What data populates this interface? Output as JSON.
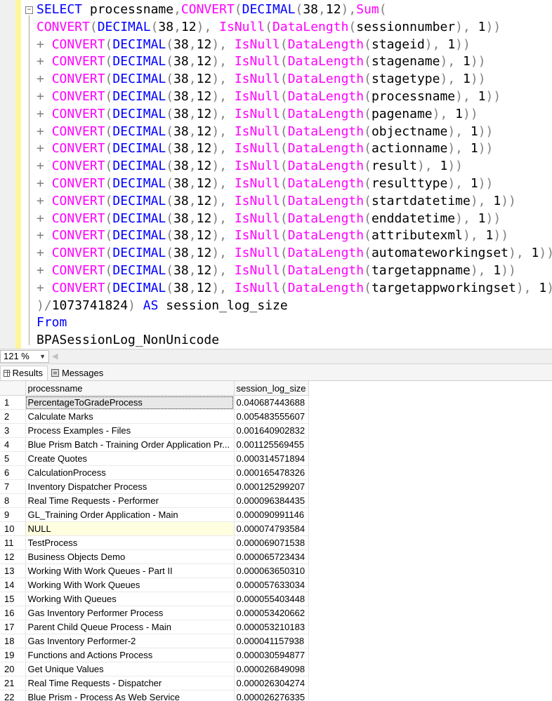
{
  "editor": {
    "lines": [
      [
        [
          "kw",
          "SELECT"
        ],
        [
          "bl",
          " processname"
        ],
        [
          "gy",
          ","
        ],
        [
          "fn",
          "CONVERT"
        ],
        [
          "gy",
          "("
        ],
        [
          "kw",
          "DECIMAL"
        ],
        [
          "gy",
          "("
        ],
        [
          "bl",
          "38"
        ],
        [
          "gy",
          ","
        ],
        [
          "bl",
          "12"
        ],
        [
          "gy",
          "),"
        ],
        [
          "fn",
          "Sum"
        ],
        [
          "gy",
          "("
        ]
      ],
      [
        [
          "fn",
          "CONVERT"
        ],
        [
          "gy",
          "("
        ],
        [
          "kw",
          "DECIMAL"
        ],
        [
          "gy",
          "("
        ],
        [
          "bl",
          "38"
        ],
        [
          "gy",
          ","
        ],
        [
          "bl",
          "12"
        ],
        [
          "gy",
          "),"
        ],
        [
          "bl",
          " "
        ],
        [
          "fn",
          "IsNull"
        ],
        [
          "gy",
          "("
        ],
        [
          "fn",
          "DataLength"
        ],
        [
          "gy",
          "("
        ],
        [
          "bl",
          "sessionnumber"
        ],
        [
          "gy",
          "),"
        ],
        [
          "bl",
          " 1"
        ],
        [
          "gy",
          "))"
        ]
      ],
      [
        [
          "gy",
          "+ "
        ],
        [
          "fn",
          "CONVERT"
        ],
        [
          "gy",
          "("
        ],
        [
          "kw",
          "DECIMAL"
        ],
        [
          "gy",
          "("
        ],
        [
          "bl",
          "38"
        ],
        [
          "gy",
          ","
        ],
        [
          "bl",
          "12"
        ],
        [
          "gy",
          "),"
        ],
        [
          "bl",
          " "
        ],
        [
          "fn",
          "IsNull"
        ],
        [
          "gy",
          "("
        ],
        [
          "fn",
          "DataLength"
        ],
        [
          "gy",
          "("
        ],
        [
          "bl",
          "stageid"
        ],
        [
          "gy",
          "),"
        ],
        [
          "bl",
          " 1"
        ],
        [
          "gy",
          "))"
        ]
      ],
      [
        [
          "gy",
          "+ "
        ],
        [
          "fn",
          "CONVERT"
        ],
        [
          "gy",
          "("
        ],
        [
          "kw",
          "DECIMAL"
        ],
        [
          "gy",
          "("
        ],
        [
          "bl",
          "38"
        ],
        [
          "gy",
          ","
        ],
        [
          "bl",
          "12"
        ],
        [
          "gy",
          "),"
        ],
        [
          "bl",
          " "
        ],
        [
          "fn",
          "IsNull"
        ],
        [
          "gy",
          "("
        ],
        [
          "fn",
          "DataLength"
        ],
        [
          "gy",
          "("
        ],
        [
          "bl",
          "stagename"
        ],
        [
          "gy",
          "),"
        ],
        [
          "bl",
          " 1"
        ],
        [
          "gy",
          "))"
        ]
      ],
      [
        [
          "gy",
          "+ "
        ],
        [
          "fn",
          "CONVERT"
        ],
        [
          "gy",
          "("
        ],
        [
          "kw",
          "DECIMAL"
        ],
        [
          "gy",
          "("
        ],
        [
          "bl",
          "38"
        ],
        [
          "gy",
          ","
        ],
        [
          "bl",
          "12"
        ],
        [
          "gy",
          "),"
        ],
        [
          "bl",
          " "
        ],
        [
          "fn",
          "IsNull"
        ],
        [
          "gy",
          "("
        ],
        [
          "fn",
          "DataLength"
        ],
        [
          "gy",
          "("
        ],
        [
          "bl",
          "stagetype"
        ],
        [
          "gy",
          "),"
        ],
        [
          "bl",
          " 1"
        ],
        [
          "gy",
          "))"
        ]
      ],
      [
        [
          "gy",
          "+ "
        ],
        [
          "fn",
          "CONVERT"
        ],
        [
          "gy",
          "("
        ],
        [
          "kw",
          "DECIMAL"
        ],
        [
          "gy",
          "("
        ],
        [
          "bl",
          "38"
        ],
        [
          "gy",
          ","
        ],
        [
          "bl",
          "12"
        ],
        [
          "gy",
          "),"
        ],
        [
          "bl",
          " "
        ],
        [
          "fn",
          "IsNull"
        ],
        [
          "gy",
          "("
        ],
        [
          "fn",
          "DataLength"
        ],
        [
          "gy",
          "("
        ],
        [
          "bl",
          "processname"
        ],
        [
          "gy",
          "),"
        ],
        [
          "bl",
          " 1"
        ],
        [
          "gy",
          "))"
        ]
      ],
      [
        [
          "gy",
          "+ "
        ],
        [
          "fn",
          "CONVERT"
        ],
        [
          "gy",
          "("
        ],
        [
          "kw",
          "DECIMAL"
        ],
        [
          "gy",
          "("
        ],
        [
          "bl",
          "38"
        ],
        [
          "gy",
          ","
        ],
        [
          "bl",
          "12"
        ],
        [
          "gy",
          "),"
        ],
        [
          "bl",
          " "
        ],
        [
          "fn",
          "IsNull"
        ],
        [
          "gy",
          "("
        ],
        [
          "fn",
          "DataLength"
        ],
        [
          "gy",
          "("
        ],
        [
          "bl",
          "pagename"
        ],
        [
          "gy",
          "),"
        ],
        [
          "bl",
          " 1"
        ],
        [
          "gy",
          "))"
        ]
      ],
      [
        [
          "gy",
          "+ "
        ],
        [
          "fn",
          "CONVERT"
        ],
        [
          "gy",
          "("
        ],
        [
          "kw",
          "DECIMAL"
        ],
        [
          "gy",
          "("
        ],
        [
          "bl",
          "38"
        ],
        [
          "gy",
          ","
        ],
        [
          "bl",
          "12"
        ],
        [
          "gy",
          "),"
        ],
        [
          "bl",
          " "
        ],
        [
          "fn",
          "IsNull"
        ],
        [
          "gy",
          "("
        ],
        [
          "fn",
          "DataLength"
        ],
        [
          "gy",
          "("
        ],
        [
          "bl",
          "objectname"
        ],
        [
          "gy",
          "),"
        ],
        [
          "bl",
          " 1"
        ],
        [
          "gy",
          "))"
        ]
      ],
      [
        [
          "gy",
          "+ "
        ],
        [
          "fn",
          "CONVERT"
        ],
        [
          "gy",
          "("
        ],
        [
          "kw",
          "DECIMAL"
        ],
        [
          "gy",
          "("
        ],
        [
          "bl",
          "38"
        ],
        [
          "gy",
          ","
        ],
        [
          "bl",
          "12"
        ],
        [
          "gy",
          "),"
        ],
        [
          "bl",
          " "
        ],
        [
          "fn",
          "IsNull"
        ],
        [
          "gy",
          "("
        ],
        [
          "fn",
          "DataLength"
        ],
        [
          "gy",
          "("
        ],
        [
          "bl",
          "actionname"
        ],
        [
          "gy",
          "),"
        ],
        [
          "bl",
          " 1"
        ],
        [
          "gy",
          "))"
        ]
      ],
      [
        [
          "gy",
          "+ "
        ],
        [
          "fn",
          "CONVERT"
        ],
        [
          "gy",
          "("
        ],
        [
          "kw",
          "DECIMAL"
        ],
        [
          "gy",
          "("
        ],
        [
          "bl",
          "38"
        ],
        [
          "gy",
          ","
        ],
        [
          "bl",
          "12"
        ],
        [
          "gy",
          "),"
        ],
        [
          "bl",
          " "
        ],
        [
          "fn",
          "IsNull"
        ],
        [
          "gy",
          "("
        ],
        [
          "fn",
          "DataLength"
        ],
        [
          "gy",
          "("
        ],
        [
          "bl",
          "result"
        ],
        [
          "gy",
          "),"
        ],
        [
          "bl",
          " 1"
        ],
        [
          "gy",
          "))"
        ]
      ],
      [
        [
          "gy",
          "+ "
        ],
        [
          "fn",
          "CONVERT"
        ],
        [
          "gy",
          "("
        ],
        [
          "kw",
          "DECIMAL"
        ],
        [
          "gy",
          "("
        ],
        [
          "bl",
          "38"
        ],
        [
          "gy",
          ","
        ],
        [
          "bl",
          "12"
        ],
        [
          "gy",
          "),"
        ],
        [
          "bl",
          " "
        ],
        [
          "fn",
          "IsNull"
        ],
        [
          "gy",
          "("
        ],
        [
          "fn",
          "DataLength"
        ],
        [
          "gy",
          "("
        ],
        [
          "bl",
          "resulttype"
        ],
        [
          "gy",
          "),"
        ],
        [
          "bl",
          " 1"
        ],
        [
          "gy",
          "))"
        ]
      ],
      [
        [
          "gy",
          "+ "
        ],
        [
          "fn",
          "CONVERT"
        ],
        [
          "gy",
          "("
        ],
        [
          "kw",
          "DECIMAL"
        ],
        [
          "gy",
          "("
        ],
        [
          "bl",
          "38"
        ],
        [
          "gy",
          ","
        ],
        [
          "bl",
          "12"
        ],
        [
          "gy",
          "),"
        ],
        [
          "bl",
          " "
        ],
        [
          "fn",
          "IsNull"
        ],
        [
          "gy",
          "("
        ],
        [
          "fn",
          "DataLength"
        ],
        [
          "gy",
          "("
        ],
        [
          "bl",
          "startdatetime"
        ],
        [
          "gy",
          "),"
        ],
        [
          "bl",
          " 1"
        ],
        [
          "gy",
          "))"
        ]
      ],
      [
        [
          "gy",
          "+ "
        ],
        [
          "fn",
          "CONVERT"
        ],
        [
          "gy",
          "("
        ],
        [
          "kw",
          "DECIMAL"
        ],
        [
          "gy",
          "("
        ],
        [
          "bl",
          "38"
        ],
        [
          "gy",
          ","
        ],
        [
          "bl",
          "12"
        ],
        [
          "gy",
          "),"
        ],
        [
          "bl",
          " "
        ],
        [
          "fn",
          "IsNull"
        ],
        [
          "gy",
          "("
        ],
        [
          "fn",
          "DataLength"
        ],
        [
          "gy",
          "("
        ],
        [
          "bl",
          "enddatetime"
        ],
        [
          "gy",
          "),"
        ],
        [
          "bl",
          " 1"
        ],
        [
          "gy",
          "))"
        ]
      ],
      [
        [
          "gy",
          "+ "
        ],
        [
          "fn",
          "CONVERT"
        ],
        [
          "gy",
          "("
        ],
        [
          "kw",
          "DECIMAL"
        ],
        [
          "gy",
          "("
        ],
        [
          "bl",
          "38"
        ],
        [
          "gy",
          ","
        ],
        [
          "bl",
          "12"
        ],
        [
          "gy",
          "),"
        ],
        [
          "bl",
          " "
        ],
        [
          "fn",
          "IsNull"
        ],
        [
          "gy",
          "("
        ],
        [
          "fn",
          "DataLength"
        ],
        [
          "gy",
          "("
        ],
        [
          "bl",
          "attributexml"
        ],
        [
          "gy",
          "),"
        ],
        [
          "bl",
          " 1"
        ],
        [
          "gy",
          "))"
        ]
      ],
      [
        [
          "gy",
          "+ "
        ],
        [
          "fn",
          "CONVERT"
        ],
        [
          "gy",
          "("
        ],
        [
          "kw",
          "DECIMAL"
        ],
        [
          "gy",
          "("
        ],
        [
          "bl",
          "38"
        ],
        [
          "gy",
          ","
        ],
        [
          "bl",
          "12"
        ],
        [
          "gy",
          "),"
        ],
        [
          "bl",
          " "
        ],
        [
          "fn",
          "IsNull"
        ],
        [
          "gy",
          "("
        ],
        [
          "fn",
          "DataLength"
        ],
        [
          "gy",
          "("
        ],
        [
          "bl",
          "automateworkingset"
        ],
        [
          "gy",
          "),"
        ],
        [
          "bl",
          " 1"
        ],
        [
          "gy",
          "))"
        ]
      ],
      [
        [
          "gy",
          "+ "
        ],
        [
          "fn",
          "CONVERT"
        ],
        [
          "gy",
          "("
        ],
        [
          "kw",
          "DECIMAL"
        ],
        [
          "gy",
          "("
        ],
        [
          "bl",
          "38"
        ],
        [
          "gy",
          ","
        ],
        [
          "bl",
          "12"
        ],
        [
          "gy",
          "),"
        ],
        [
          "bl",
          " "
        ],
        [
          "fn",
          "IsNull"
        ],
        [
          "gy",
          "("
        ],
        [
          "fn",
          "DataLength"
        ],
        [
          "gy",
          "("
        ],
        [
          "bl",
          "targetappname"
        ],
        [
          "gy",
          "),"
        ],
        [
          "bl",
          " 1"
        ],
        [
          "gy",
          "))"
        ]
      ],
      [
        [
          "gy",
          "+ "
        ],
        [
          "fn",
          "CONVERT"
        ],
        [
          "gy",
          "("
        ],
        [
          "kw",
          "DECIMAL"
        ],
        [
          "gy",
          "("
        ],
        [
          "bl",
          "38"
        ],
        [
          "gy",
          ","
        ],
        [
          "bl",
          "12"
        ],
        [
          "gy",
          "),"
        ],
        [
          "bl",
          " "
        ],
        [
          "fn",
          "IsNull"
        ],
        [
          "gy",
          "("
        ],
        [
          "fn",
          "DataLength"
        ],
        [
          "gy",
          "("
        ],
        [
          "bl",
          "targetappworkingset"
        ],
        [
          "gy",
          "),"
        ],
        [
          "bl",
          " 1"
        ],
        [
          "gy",
          "))"
        ]
      ],
      [
        [
          "gy",
          ")/"
        ],
        [
          "bl",
          "1073741824"
        ],
        [
          "gy",
          ")"
        ],
        [
          "bl",
          " "
        ],
        [
          "kw",
          "AS"
        ],
        [
          "bl",
          " session_log_size"
        ]
      ],
      [
        [
          "kw",
          "From"
        ]
      ],
      [
        [
          "bl",
          "BPASessionLog_NonUnicode"
        ]
      ]
    ]
  },
  "zoom": {
    "value": "121 %"
  },
  "tabs": {
    "results_label": "Results",
    "messages_label": "Messages"
  },
  "grid": {
    "headers": {
      "col1": "processname",
      "col2": "session_log_size"
    },
    "rows": [
      {
        "n": "1",
        "name": "PercentageToGradeProcess",
        "size": "0.040687443688"
      },
      {
        "n": "2",
        "name": "Calculate Marks",
        "size": "0.005483555607"
      },
      {
        "n": "3",
        "name": "Process Examples - Files",
        "size": "0.001640902832"
      },
      {
        "n": "4",
        "name": "Blue Prism Batch - Training Order Application Pr...",
        "size": "0.001125569455"
      },
      {
        "n": "5",
        "name": "Create Quotes",
        "size": "0.000314571894"
      },
      {
        "n": "6",
        "name": "CalculationProcess",
        "size": "0.000165478326"
      },
      {
        "n": "7",
        "name": "Inventory Dispatcher Process",
        "size": "0.000125299207"
      },
      {
        "n": "8",
        "name": "Real Time Requests - Performer",
        "size": "0.000096384435"
      },
      {
        "n": "9",
        "name": "GL_Training Order Application - Main",
        "size": "0.000090991146"
      },
      {
        "n": "10",
        "name": "NULL",
        "size": "0.000074793584"
      },
      {
        "n": "11",
        "name": "TestProcess",
        "size": "0.000069071538"
      },
      {
        "n": "12",
        "name": "Business Objects Demo",
        "size": "0.000065723434"
      },
      {
        "n": "13",
        "name": "Working With Work Queues - Part II",
        "size": "0.000063650310"
      },
      {
        "n": "14",
        "name": "Working With Work Queues",
        "size": "0.000057633034"
      },
      {
        "n": "15",
        "name": "Working With Queues",
        "size": "0.000055403448"
      },
      {
        "n": "16",
        "name": "Gas Inventory Performer Process",
        "size": "0.000053420662"
      },
      {
        "n": "17",
        "name": "Parent Child Queue Process - Main",
        "size": "0.000053210183"
      },
      {
        "n": "18",
        "name": "Gas Inventory Performer-2",
        "size": "0.000041157938"
      },
      {
        "n": "19",
        "name": "Functions and Actions Process",
        "size": "0.000030594877"
      },
      {
        "n": "20",
        "name": "Get Unique Values",
        "size": "0.000026849098"
      },
      {
        "n": "21",
        "name": "Real Time Requests - Dispatcher",
        "size": "0.000026304274"
      },
      {
        "n": "22",
        "name": "Blue Prism - Process As Web Service",
        "size": "0.000026276335"
      }
    ]
  }
}
